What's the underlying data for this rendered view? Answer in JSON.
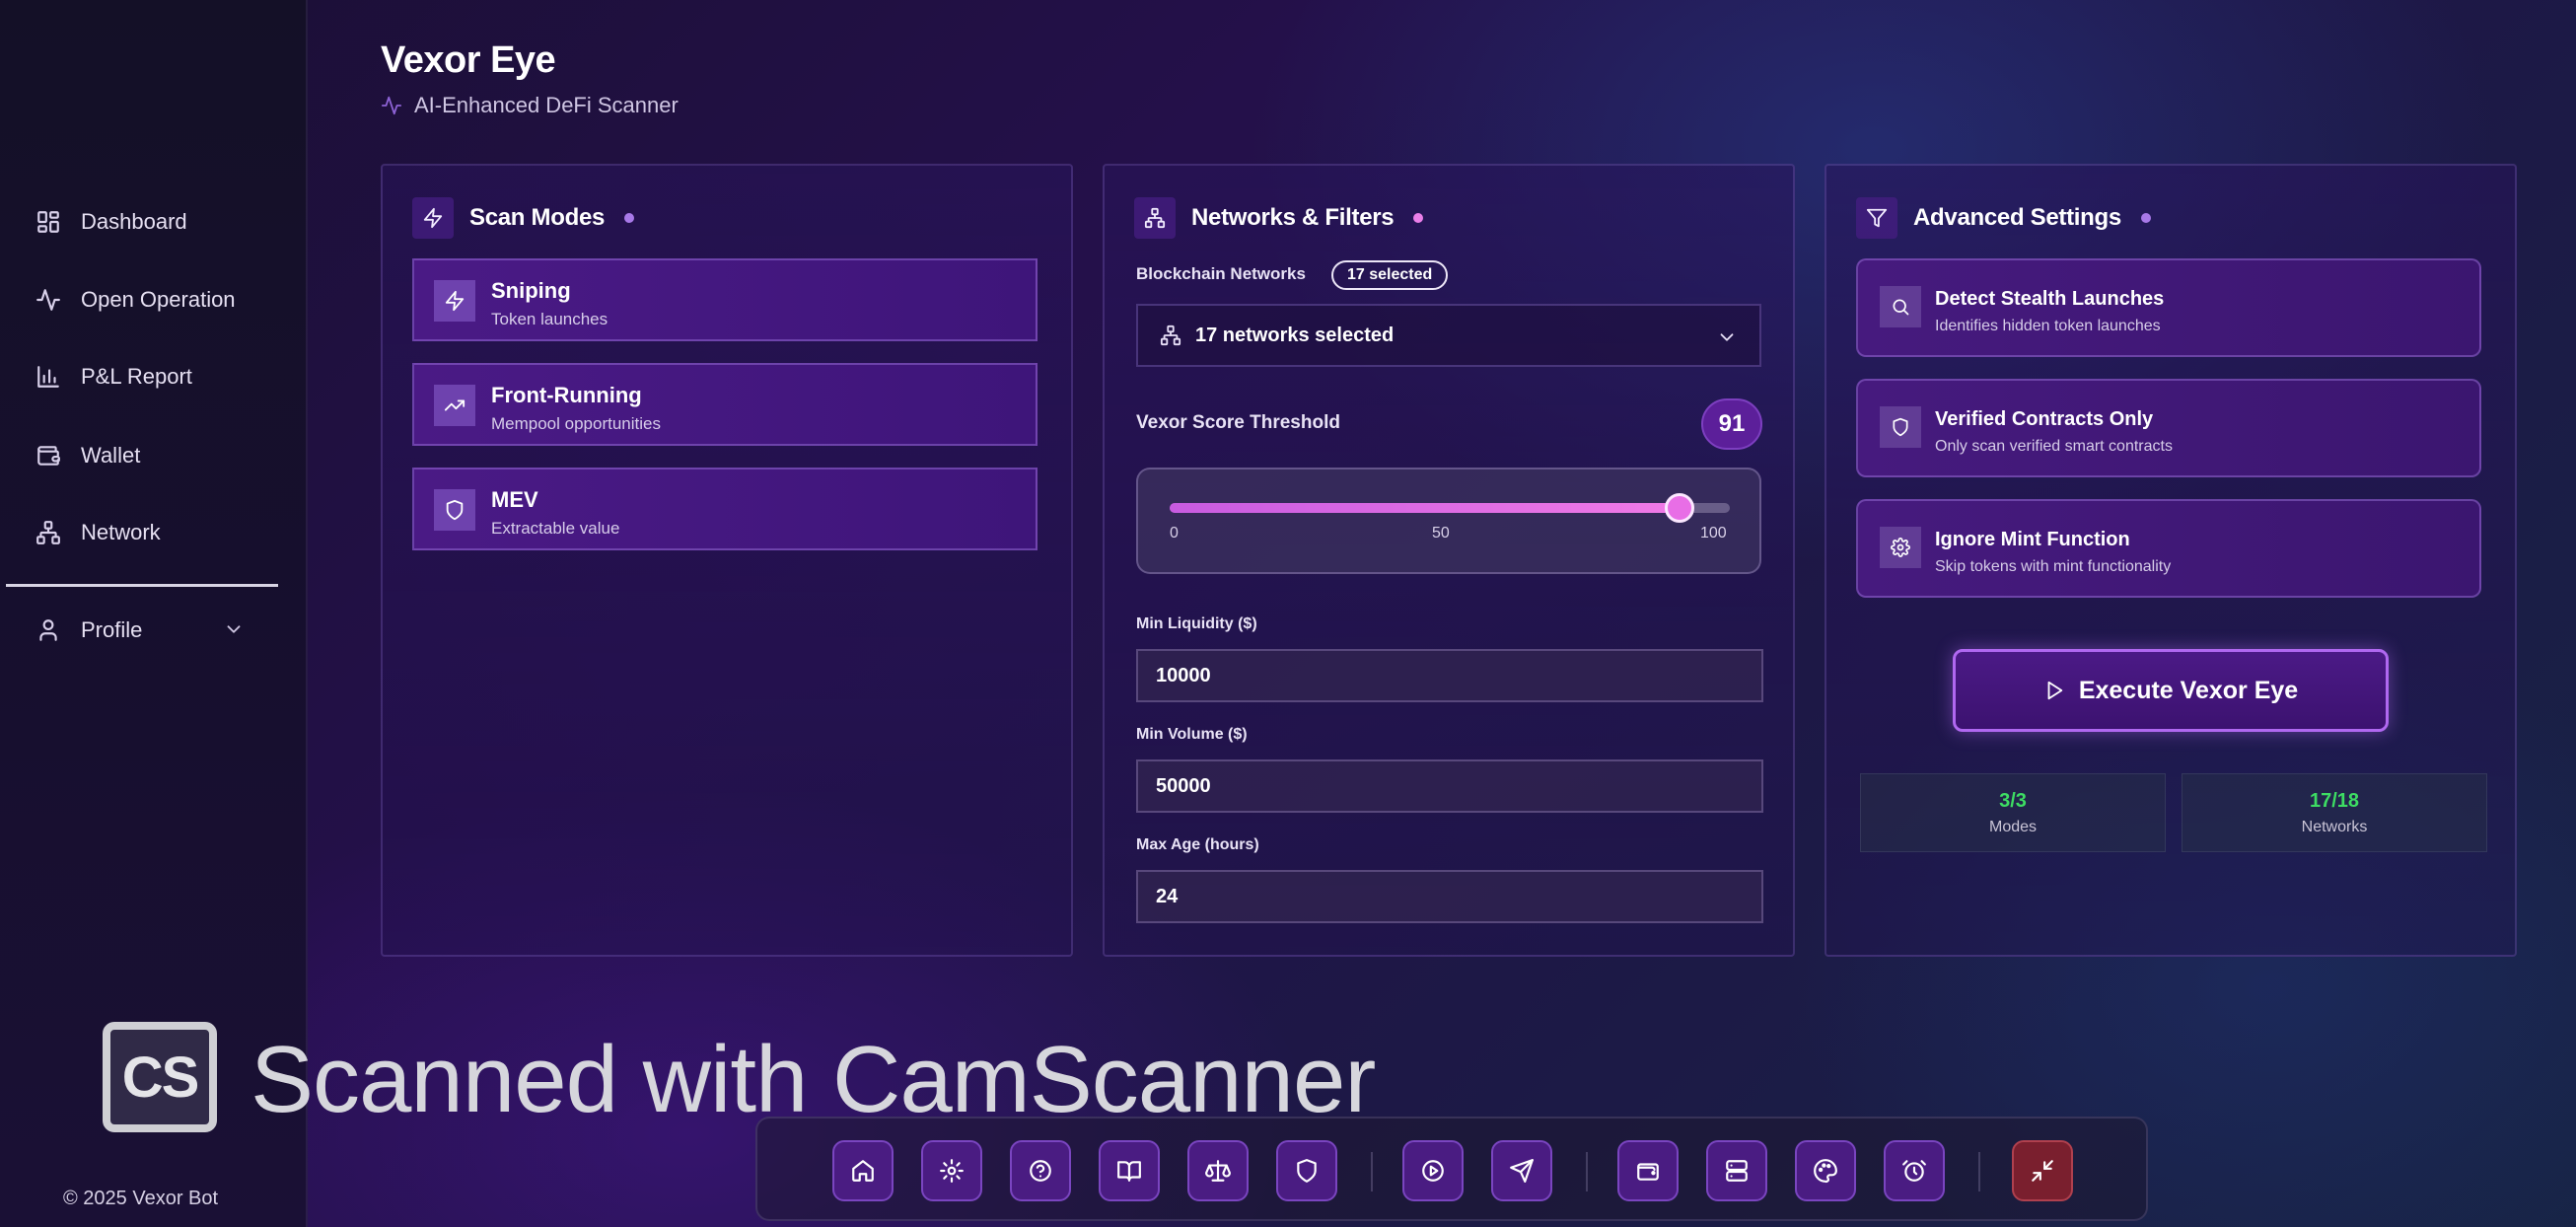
{
  "app": {
    "title": "Vexor Eye",
    "subtitle": "AI-Enhanced DeFi Scanner",
    "footer": "© 2025 Vexor Bot",
    "accent": "#b068f0",
    "success": "#3ddc63"
  },
  "sidebar": {
    "items": [
      {
        "label": "Dashboard",
        "icon": "dashboard-grid-icon"
      },
      {
        "label": "Open Operation",
        "icon": "activity-icon"
      },
      {
        "label": "P&L Report",
        "icon": "bar-chart-icon"
      },
      {
        "label": "Wallet",
        "icon": "wallet-icon"
      },
      {
        "label": "Network",
        "icon": "network-icon"
      }
    ],
    "profile": {
      "label": "Profile",
      "icon": "user-icon"
    }
  },
  "scan_modes": {
    "title": "Scan Modes",
    "modes": [
      {
        "name": "Sniping",
        "desc": "Token launches",
        "icon": "bolt-icon"
      },
      {
        "name": "Front-Running",
        "desc": "Mempool opportunities",
        "icon": "trending-up-icon"
      },
      {
        "name": "MEV",
        "desc": "Extractable value",
        "icon": "shield-icon"
      }
    ]
  },
  "networks": {
    "title": "Networks & Filters",
    "blockchain_label": "Blockchain Networks",
    "badge": "17 selected",
    "select_value": "17 networks selected",
    "score_label": "Vexor Score Threshold",
    "score_value": "91",
    "slider": {
      "value": 91,
      "min": 0,
      "max": 100,
      "ticks": [
        "0",
        "50",
        "100"
      ]
    },
    "min_liquidity_label": "Min Liquidity ($)",
    "min_liquidity": "10000",
    "min_volume_label": "Min Volume ($)",
    "min_volume": "50000",
    "max_age_label": "Max Age (hours)",
    "max_age": "24"
  },
  "advanced": {
    "title": "Advanced Settings",
    "settings": [
      {
        "name": "Detect Stealth Launches",
        "desc": "Identifies hidden token launches",
        "icon": "search-icon"
      },
      {
        "name": "Verified Contracts Only",
        "desc": "Only scan verified smart contracts",
        "icon": "shield-icon"
      },
      {
        "name": "Ignore Mint Function",
        "desc": "Skip tokens with mint functionality",
        "icon": "gear-icon"
      }
    ],
    "execute_label": "Execute Vexor Eye",
    "stats": [
      {
        "value": "3/3",
        "label": "Modes"
      },
      {
        "value": "17/18",
        "label": "Networks"
      }
    ]
  },
  "watermark": {
    "logo": "CS",
    "text": "Scanned with CamScanner"
  },
  "dock": {
    "icons": [
      "home-icon",
      "gear-icon",
      "help-icon",
      "book-icon",
      "scale-icon",
      "shield-icon",
      "play-icon",
      "send-icon",
      "wallet-icon",
      "server-icon",
      "palette-icon",
      "alarm-icon",
      "minimize-icon"
    ]
  }
}
